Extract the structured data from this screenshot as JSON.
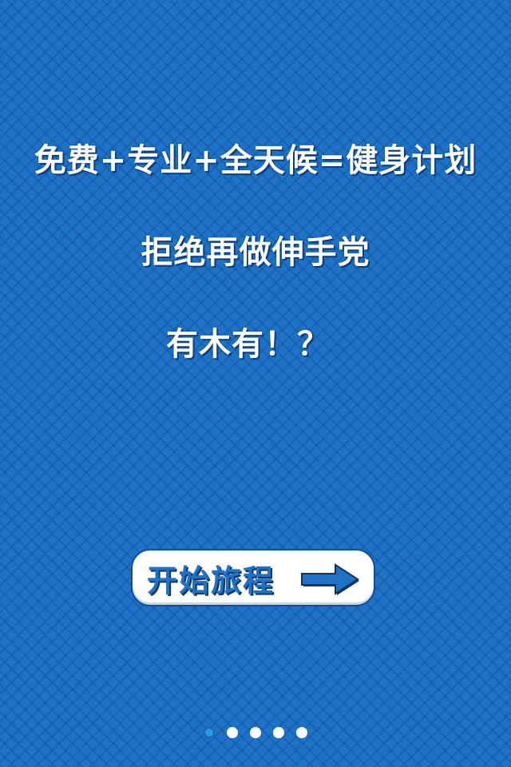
{
  "headline": {
    "line1": "免费+专业+全天候=健身计划",
    "line2": "拒绝再做伸手党",
    "line3": "有木有！？"
  },
  "start_button": {
    "label": "开始旅程",
    "icon": "arrow-right-icon"
  },
  "pager": {
    "count": 5,
    "active_index": 0
  },
  "colors": {
    "background": "#1e73c6",
    "text": "#ffffff",
    "button_bg": "#ffffff",
    "button_text": "#1e73c6",
    "dot_active": "#2a9be0",
    "dot_inactive": "#ffffff"
  }
}
